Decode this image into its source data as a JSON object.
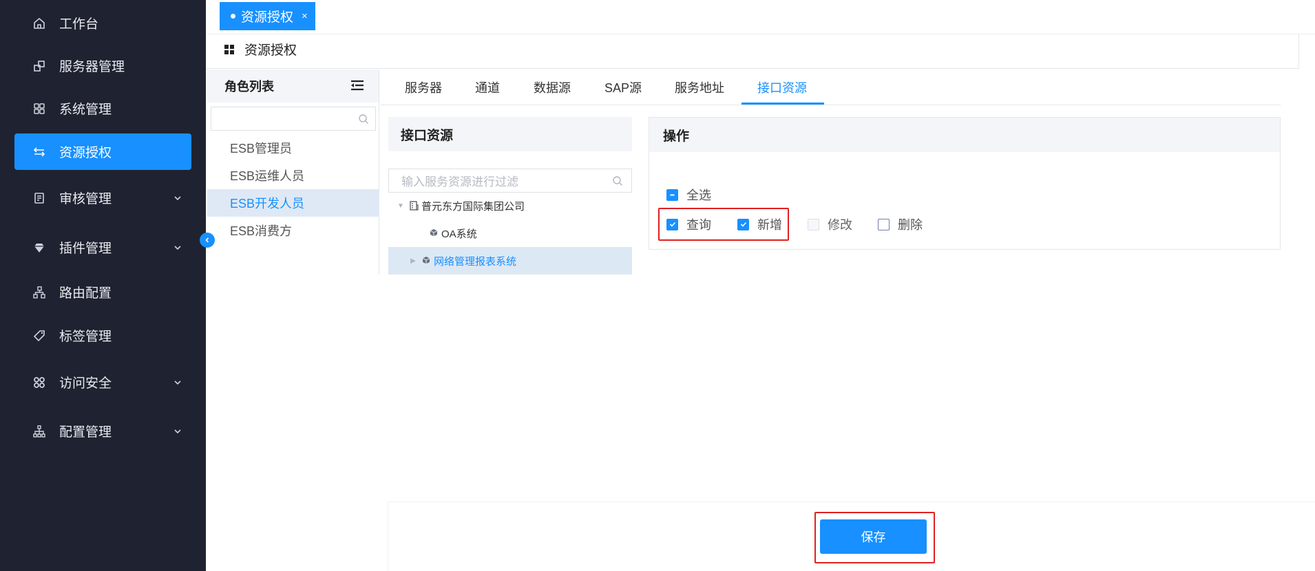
{
  "sidebar": {
    "items": [
      {
        "label": "工作台",
        "icon": "home-icon"
      },
      {
        "label": "服务器管理",
        "icon": "server-icon"
      },
      {
        "label": "系统管理",
        "icon": "apps-icon"
      },
      {
        "label": "资源授权",
        "icon": "swap-icon",
        "active": true
      },
      {
        "label": "审核管理",
        "icon": "audit-icon",
        "expandable": true
      },
      {
        "label": "插件管理",
        "icon": "gem-icon",
        "expandable": true
      },
      {
        "label": "路由配置",
        "icon": "route-icon"
      },
      {
        "label": "标签管理",
        "icon": "tag-icon"
      },
      {
        "label": "访问安全",
        "icon": "security-icon",
        "expandable": true
      },
      {
        "label": "配置管理",
        "icon": "config-icon",
        "expandable": true
      }
    ]
  },
  "tab_bar": {
    "open_tab": "资源授权",
    "close": "×"
  },
  "page": {
    "title": "资源授权"
  },
  "roles": {
    "header": "角色列表",
    "search_value": "",
    "items": [
      "ESB管理员",
      "ESB运维人员",
      "ESB开发人员",
      "ESB消费方"
    ],
    "selected": "ESB开发人员"
  },
  "tabs": {
    "items": [
      "服务器",
      "通道",
      "数据源",
      "SAP源",
      "服务地址",
      "接口资源"
    ],
    "active": "接口资源"
  },
  "resource": {
    "header": "接口资源",
    "search_placeholder": "输入服务资源进行过滤",
    "tree": [
      "普元东方国际集团公司",
      "OA系统",
      "网络管理报表系统"
    ],
    "selected": "网络管理报表系统"
  },
  "operations": {
    "header": "操作",
    "select_all": "全选",
    "items": [
      {
        "label": "查询",
        "checked": true
      },
      {
        "label": "新增",
        "checked": true
      },
      {
        "label": "修改",
        "checked": false,
        "disabled": true
      },
      {
        "label": "删除",
        "checked": false
      }
    ]
  },
  "footer": {
    "save_label": "保存"
  },
  "colors": {
    "sidebar_bg": "#1f2230",
    "accent": "#1890ff",
    "highlight": "#e02020"
  }
}
